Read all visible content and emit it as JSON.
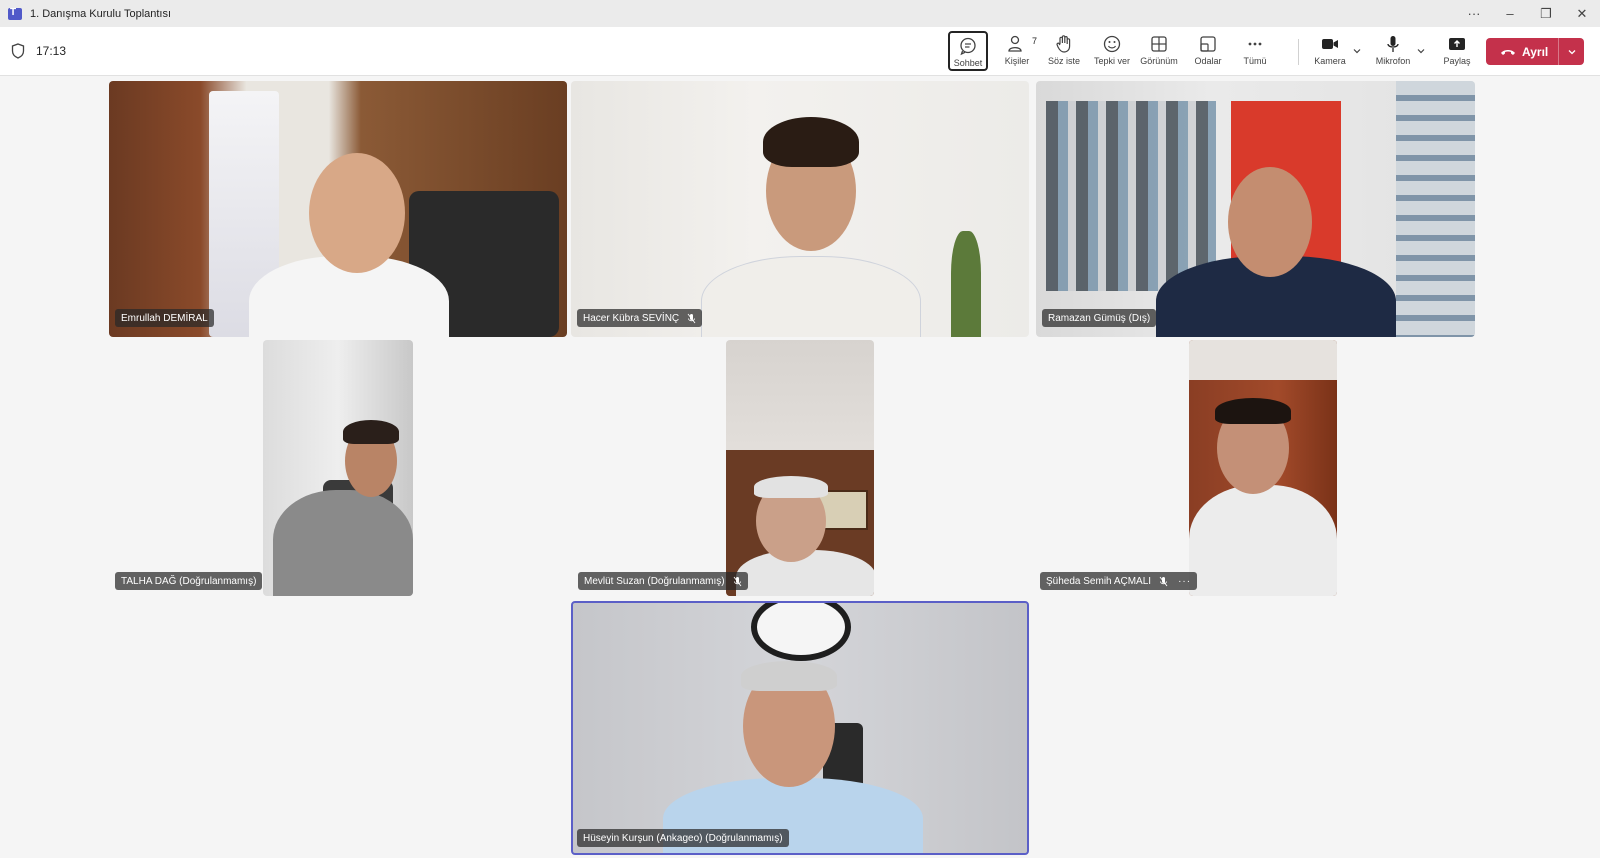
{
  "window": {
    "title": "1. Danışma Kurulu Toplantısı",
    "controls": [
      "···",
      "–",
      "❐",
      "✕"
    ]
  },
  "toolbar": {
    "timer": "17:13",
    "tools": [
      {
        "label": "Sohbet",
        "icon": "chat-icon",
        "active": true
      },
      {
        "label": "Kişiler",
        "icon": "people-icon",
        "badge": "7"
      },
      {
        "label": "Söz iste",
        "icon": "raise-hand-icon"
      },
      {
        "label": "Tepki ver",
        "icon": "emoji-icon"
      },
      {
        "label": "Görünüm",
        "icon": "grid-view-icon"
      },
      {
        "label": "Odalar",
        "icon": "rooms-icon"
      },
      {
        "label": "Tümü",
        "icon": "more-icon"
      },
      {
        "label": "Kamera",
        "icon": "camera-icon"
      },
      {
        "label": "Mikrofon",
        "icon": "microphone-icon"
      },
      {
        "label": "Paylaş",
        "icon": "share-icon"
      }
    ],
    "leave_label": "Ayrıl",
    "leave_color": "#c4314b"
  },
  "participants": [
    {
      "name": "Emrullah DEMİRAL",
      "muted": false
    },
    {
      "name": "Hacer Kübra SEVİNÇ",
      "muted": true
    },
    {
      "name": "Ramazan Gümüş (Dış)",
      "muted": false
    },
    {
      "name": "TALHA DAĞ (Doğrulanmamış)",
      "muted": false
    },
    {
      "name": "Mevlüt Suzan (Doğrulanmamış)",
      "muted": true
    },
    {
      "name": "Şüheda Semih AÇMALI",
      "muted": true,
      "more": "···"
    },
    {
      "name": "Hüseyin Kurşun (Ankageo) (Doğrulanmamış)",
      "muted": false,
      "speaking": true
    }
  ],
  "colors": {
    "speaking_border": "#5b5fc7",
    "brand": "#5059c9"
  }
}
